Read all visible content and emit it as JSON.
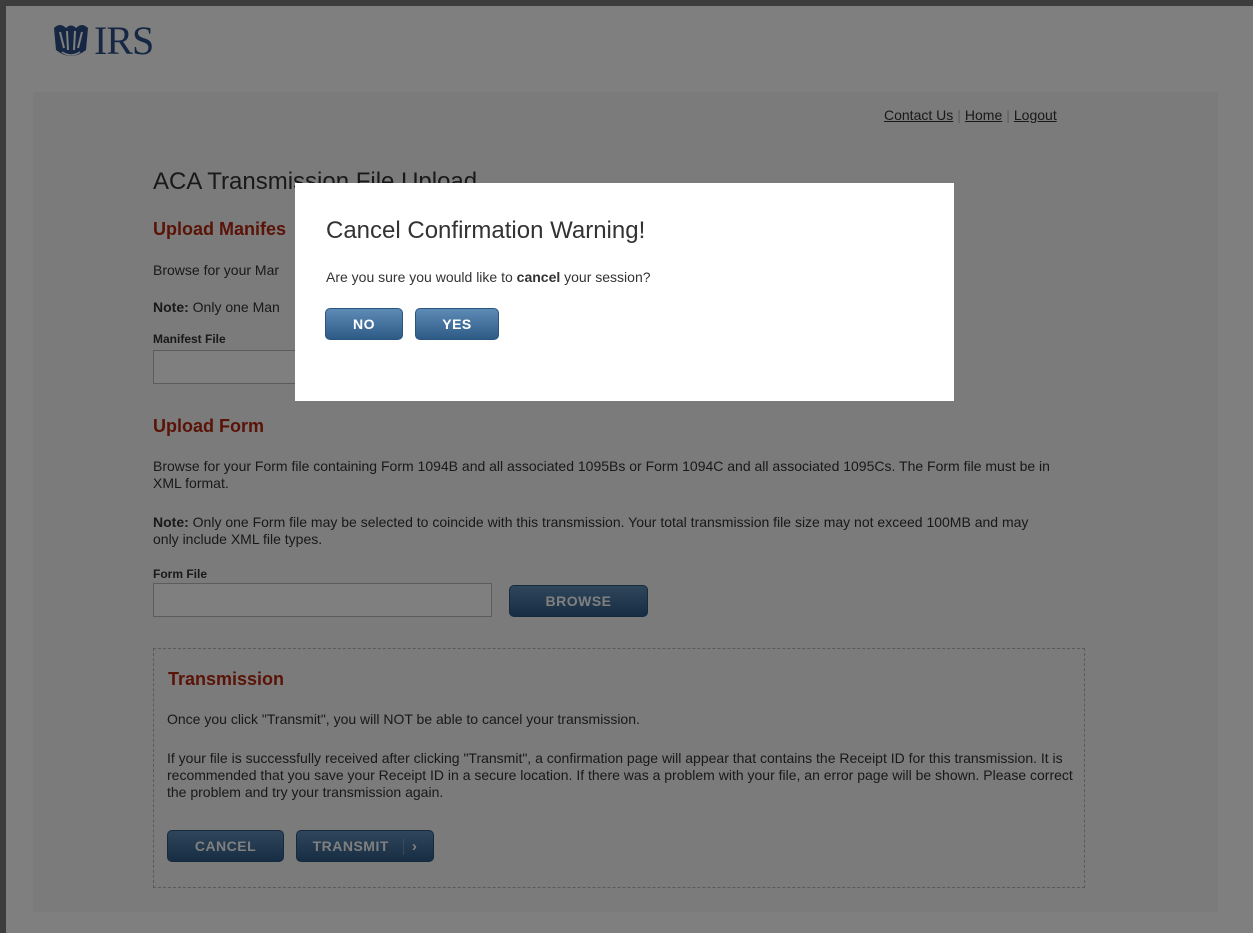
{
  "header": {
    "logo_text": "IRS",
    "links": [
      "Contact Us",
      "Home",
      "Logout"
    ]
  },
  "page": {
    "title": "ACA Transmission File Upload"
  },
  "manifest_section": {
    "heading": "Upload Manifes",
    "description": "Browse for your Mar",
    "note_label": "Note:",
    "note_text": " Only one Man",
    "field_label": "Manifest File"
  },
  "form_section": {
    "heading": "Upload Form",
    "description": "Browse for your Form file containing Form 1094B and all associated 1095Bs or Form 1094C and all associated 1095Cs. The Form file must be in XML format.",
    "note_label": "Note:",
    "note_text": " Only one Form file may be selected to coincide with this transmission. Your total transmission file size may not exceed 100MB and may only include XML file types.",
    "field_label": "Form File",
    "browse_label": "BROWSE"
  },
  "transmission": {
    "heading": "Transmission",
    "warning": "Once you click \"Transmit\", you will NOT be able to cancel your transmission.",
    "info": "If your file is successfully received after clicking \"Transmit\", a confirmation page will appear that contains the Receipt ID for this transmission. It is recommended that you save your Receipt ID in a secure location. If there was a problem with your file, an error page will be shown. Please correct the problem and try your transmission again.",
    "cancel_label": "CANCEL",
    "transmit_label": "TRANSMIT",
    "transmit_chevron": "›"
  },
  "modal": {
    "title": "Cancel Confirmation Warning!",
    "text_before": "Are you sure you would like to ",
    "text_bold": "cancel",
    "text_after": " your session?",
    "no_label": "NO",
    "yes_label": "YES"
  },
  "colors": {
    "brand_blue": "#2a4e86",
    "heading_red": "#b4260f",
    "button_blue": "#3d6b97"
  }
}
